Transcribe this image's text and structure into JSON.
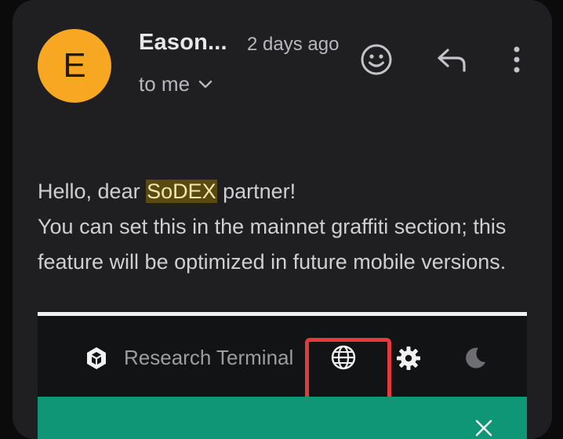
{
  "email": {
    "avatar_letter": "E",
    "avatar_color": "#f7a721",
    "sender": "Eason...",
    "time": "2 days ago",
    "recipient": "to me"
  },
  "actions": {
    "emoji_icon": "smiley-face-icon",
    "reply_icon": "reply-arrow-icon",
    "more_icon": "vertical-dots-icon",
    "expand_icon": "chevron-down-icon"
  },
  "message": {
    "greeting_prefix": "Hello, dear ",
    "highlight": "SoDEX",
    "greeting_suffix": " partner!",
    "line2": "You can set this in the mainnet graffiti section; this feature will be optimized in future mobile versions."
  },
  "embedded_screenshot": {
    "title": "Research Terminal",
    "logo_icon": "cube-logo-icon",
    "globe_icon": "globe-icon",
    "settings_icon": "gear-icon",
    "theme_icon": "moon-icon",
    "close_icon": "close-icon",
    "highlight_color": "#e23a3f",
    "banner_color": "#0f9677"
  }
}
